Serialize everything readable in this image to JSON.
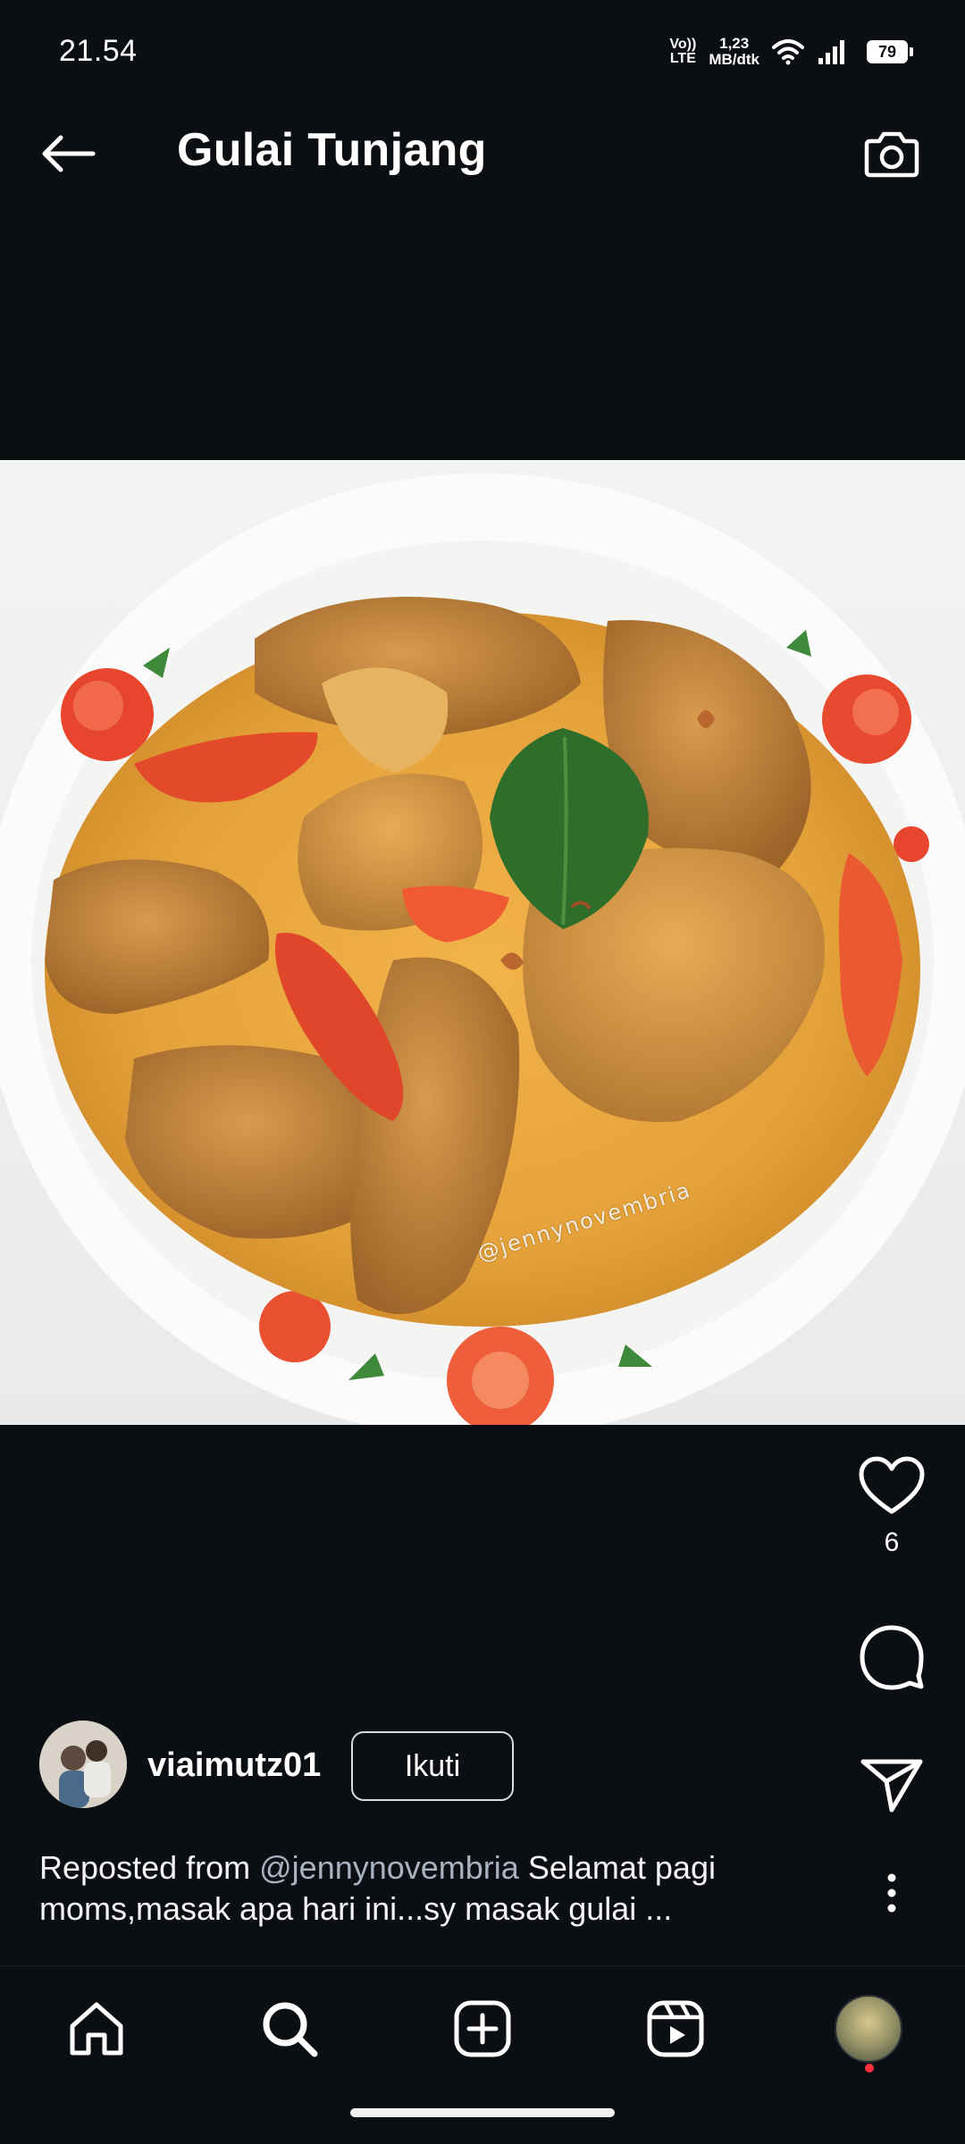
{
  "status_bar": {
    "time": "21.54",
    "volte_top": "Vo))",
    "volte_bottom": "LTE",
    "speed_value": "1,23",
    "speed_unit": "MB/dtk",
    "battery": "79"
  },
  "header": {
    "title": "Gulai Tunjang",
    "back_icon": "arrow-left-icon",
    "camera_icon": "camera-icon"
  },
  "post": {
    "image_description_icon": "food-photo",
    "watermark": "@jennynovembria",
    "likes": "6",
    "author": {
      "username": "viaimutz01",
      "follow_label": "Ikuti"
    },
    "caption": {
      "prefix": "Reposted from ",
      "mention": "@jennynovembria",
      "text": " Selamat pagi moms,masak apa hari ini...sy masak gulai ..."
    }
  },
  "nav": {
    "items": [
      "home-icon",
      "search-icon",
      "add-post-icon",
      "reels-icon",
      "profile-avatar"
    ]
  },
  "colors": {
    "background": "#0b0e13",
    "text": "#ffffff",
    "mention": "#a9b3bf",
    "notification": "#ff3040",
    "curry": "#e6a23a",
    "chili": "#e24a2a",
    "leaf": "#2f6d2a"
  }
}
